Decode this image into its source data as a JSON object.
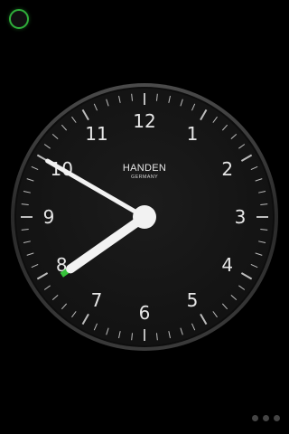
{
  "clock": {
    "numerals": [
      "12",
      "1",
      "2",
      "3",
      "4",
      "5",
      "6",
      "7",
      "8",
      "9",
      "10",
      "11"
    ],
    "brand": "HANDEN",
    "subbrand": "GERMANY",
    "time": {
      "hour": 7,
      "minute": 50
    },
    "colors": {
      "face": "#161616",
      "bezel": "#3a3a3a",
      "hands": "#f2f2f2",
      "ticks": "#bdbdbd",
      "accent": "#36c23a"
    }
  },
  "status_indicator": {
    "icon": "status-ring-icon",
    "color": "#2fae3a"
  },
  "page_indicator": {
    "count": 3,
    "icon": "page-dot-icon"
  }
}
